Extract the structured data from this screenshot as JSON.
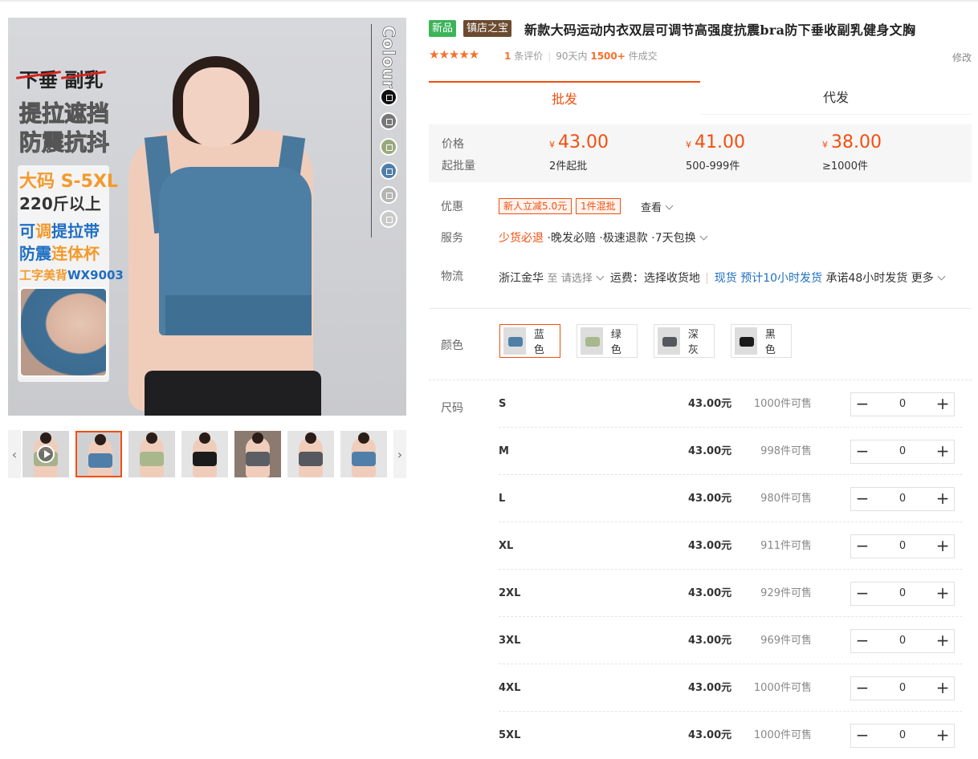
{
  "gallery": {
    "overlay": {
      "strike_1": "下垂",
      "strike_2": "副乳",
      "line_2": "提拉遮挡",
      "line_3": "防震抗抖",
      "badge_1_a": "大码",
      "badge_1_b": "S-5XL",
      "badge_2": "220斤以上",
      "badge_3_a": "可",
      "badge_3_b": "调",
      "badge_3_c": "提拉带",
      "badge_4_a": "防震",
      "badge_4_b": "连体杯",
      "badge_5_a": "工字美背",
      "badge_5_b": "WX9003",
      "colour_label": "Colour"
    },
    "colour_dots": [
      "#111111",
      "#777777",
      "#9aa97d",
      "#4f7fa8",
      "#b5b5b5",
      "#c9c9c9"
    ],
    "thumbnails": [
      {
        "name": "video",
        "bra": "#a7b28d",
        "bg": "#d8d8d8"
      },
      {
        "name": "blue",
        "bra": "#4f7fa8",
        "bg": "#cfd0d4"
      },
      {
        "name": "green",
        "bra": "#a9b78c",
        "bg": "#dcdcdc"
      },
      {
        "name": "black-back",
        "bra": "#1b1b1b",
        "bg": "#e4e4e4"
      },
      {
        "name": "grey-detail",
        "bra": "#5b5e63",
        "bg": "#8a7a70"
      },
      {
        "name": "deep-grey",
        "bra": "#55585e",
        "bg": "#e4e4e4"
      },
      {
        "name": "blue-2",
        "bra": "#4f7fa8",
        "bg": "#e4e4e4"
      }
    ]
  },
  "product": {
    "tag_new": "新品",
    "tag_shop": "镇店之宝",
    "title": "新款大码运动内衣双层可调节高强度抗震bra防下垂收副乳健身文胸",
    "stars": "★★★★★",
    "review_count": "1",
    "review_label": "条评价",
    "period": "90天内",
    "sold": "1500+",
    "sold_label": "件成交",
    "modify": "修改"
  },
  "tabs": {
    "wholesale": "批发",
    "dropship": "代发"
  },
  "pricing": {
    "price_label": "价格",
    "moq_label": "起批量",
    "currency": "¥",
    "tiers": [
      {
        "price": "43.00",
        "qty": "2件起批"
      },
      {
        "price": "41.00",
        "qty": "500-999件"
      },
      {
        "price": "38.00",
        "qty": "≥1000件"
      }
    ]
  },
  "promo": {
    "label": "优惠",
    "tag_1": "新人立减5.0元",
    "tag_2": "1件混批",
    "view": "查看"
  },
  "service": {
    "label": "服务",
    "item_1": "少货必退",
    "item_2": "晚发必赔",
    "item_3": "极速退款",
    "item_4": "7天包换",
    "dot": "·"
  },
  "logistics": {
    "label": "物流",
    "origin": "浙江金华",
    "to": "至",
    "select": "请选择",
    "freight": "运费：选择收货地",
    "stock": "现货",
    "ship_time": "预计10小时发货",
    "promise": "承诺48小时发货",
    "more": "更多"
  },
  "colors": {
    "label": "颜色",
    "options": [
      {
        "label": "蓝色",
        "swatch": "#4f7fa8"
      },
      {
        "label": "绿色",
        "swatch": "#a9b78c"
      },
      {
        "label": "深灰",
        "swatch": "#55585e"
      },
      {
        "label": "黑色",
        "swatch": "#1b1b1b"
      }
    ]
  },
  "sizes": {
    "label": "尺码",
    "unit": "元",
    "avail_suffix": "件可售",
    "rows": [
      {
        "size": "S",
        "price": "43.00元",
        "avail": "1000件可售",
        "qty": "0"
      },
      {
        "size": "M",
        "price": "43.00元",
        "avail": "998件可售",
        "qty": "0"
      },
      {
        "size": "L",
        "price": "43.00元",
        "avail": "980件可售",
        "qty": "0"
      },
      {
        "size": "XL",
        "price": "43.00元",
        "avail": "911件可售",
        "qty": "0"
      },
      {
        "size": "2XL",
        "price": "43.00元",
        "avail": "929件可售",
        "qty": "0"
      },
      {
        "size": "3XL",
        "price": "43.00元",
        "avail": "969件可售",
        "qty": "0"
      },
      {
        "size": "4XL",
        "price": "43.00元",
        "avail": "1000件可售",
        "qty": "0"
      },
      {
        "size": "5XL",
        "price": "43.00元",
        "avail": "1000件可售",
        "qty": "0"
      }
    ],
    "minus": "−",
    "plus": "+"
  },
  "accent": "#f44e0e"
}
